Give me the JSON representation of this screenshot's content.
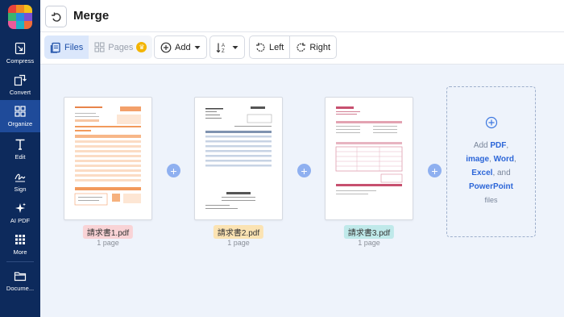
{
  "app": {
    "logo_colors": [
      "#e8423c",
      "#f08b23",
      "#f4c21a",
      "#3bb56f",
      "#2a8be0",
      "#7a4fd4",
      "#ec5a9a",
      "#1fb3c7",
      "#f06d3a"
    ]
  },
  "sidebar": {
    "items": [
      {
        "label": "Compress",
        "icon": "compress-icon"
      },
      {
        "label": "Convert",
        "icon": "convert-icon"
      },
      {
        "label": "Organize",
        "icon": "organize-icon",
        "active": true
      },
      {
        "label": "Edit",
        "icon": "edit-icon"
      },
      {
        "label": "Sign",
        "icon": "sign-icon"
      },
      {
        "label": "AI PDF",
        "icon": "ai-sparkle-icon"
      },
      {
        "label": "More",
        "icon": "grid-dots-icon"
      },
      {
        "label": "Docume...",
        "icon": "folder-icon"
      }
    ]
  },
  "header": {
    "title": "Merge",
    "back_icon": "undo-icon"
  },
  "toolbar": {
    "files": "Files",
    "pages": "Pages",
    "add": "Add",
    "left": "Left",
    "right": "Right"
  },
  "files": [
    {
      "name": "請求書1.pdf",
      "pages": "1 page",
      "badge_color": "#f9d3d6",
      "accent": "#f29a5c"
    },
    {
      "name": "請求書2.pdf",
      "pages": "1 page",
      "badge_color": "#fbe3b3",
      "accent": "#9fb2c9"
    },
    {
      "name": "請求書3.pdf",
      "pages": "1 page",
      "badge_color": "#bfe9ea",
      "accent": "#d9879c"
    }
  ],
  "dropzone": {
    "pre": "Add",
    "pdf": "PDF",
    "comma1": ",",
    "image": "image",
    "comma2": ",",
    "word": "Word",
    "comma3": ",",
    "excel": "Excel",
    "and": "and",
    "ppt": "PowerPoint",
    "files": "files"
  }
}
